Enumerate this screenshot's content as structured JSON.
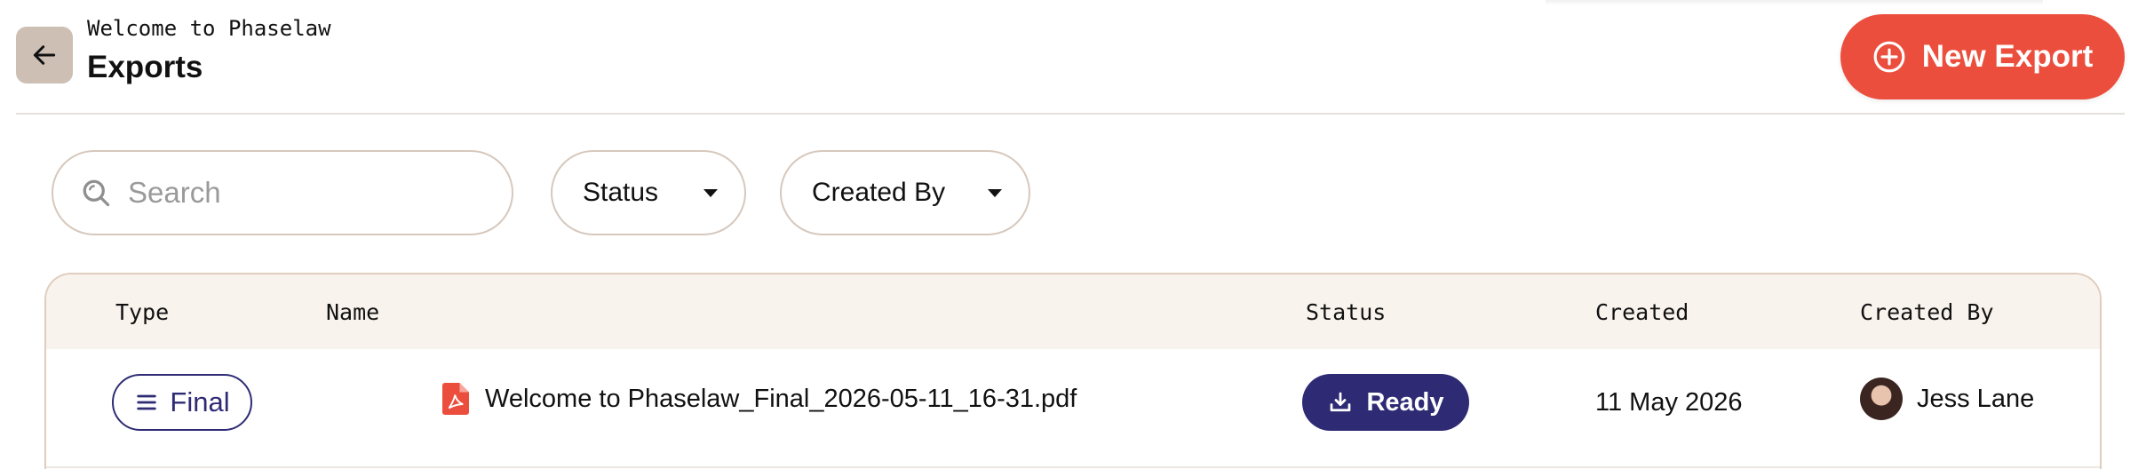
{
  "header": {
    "subtitle": "Welcome to Phaselaw",
    "title": "Exports",
    "new_export_label": "New Export"
  },
  "filters": {
    "search_placeholder": "Search",
    "status_label": "Status",
    "created_by_label": "Created By"
  },
  "table": {
    "columns": [
      "Type",
      "Name",
      "Status",
      "Created",
      "Created By"
    ],
    "rows": [
      {
        "type": "Final",
        "name": "Welcome to Phaselaw_Final_2026-05-11_16-31.pdf",
        "status": "Ready",
        "created": "11 May 2026",
        "created_by": "Jess Lane"
      }
    ]
  },
  "icons": {
    "back": "arrow-left-icon",
    "new_export": "plus-circle-icon",
    "search": "search-icon",
    "dropdown": "caret-down-icon",
    "type": "list-icon",
    "file": "pdf-icon",
    "status": "download-icon"
  },
  "colors": {
    "accent": "#ec4e3d",
    "primary": "#2e2b74",
    "back_button": "#cdbfb4",
    "table_header": "#f8f3ed",
    "border": "#d6c8bd"
  }
}
